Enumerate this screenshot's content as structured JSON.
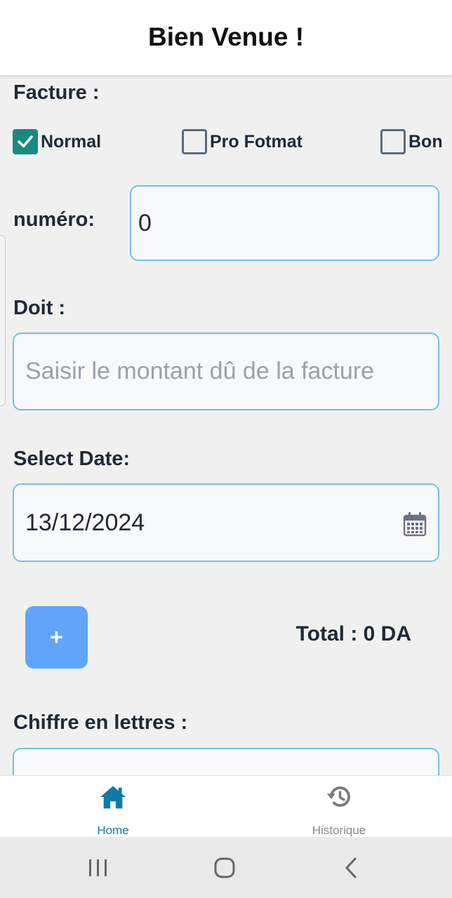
{
  "header": {
    "title": "Bien Venue !"
  },
  "facture": {
    "label": "Facture :",
    "options": [
      {
        "label": "Normal",
        "checked": true
      },
      {
        "label": "Pro Fotmat",
        "checked": false
      },
      {
        "label": "Bon",
        "checked": false
      }
    ]
  },
  "numero": {
    "label": "numéro:",
    "value": "0"
  },
  "doit": {
    "label": "Doit :",
    "placeholder": "Saisir le montant dû de la facture"
  },
  "date": {
    "label": "Select Date:",
    "value": "13/12/2024"
  },
  "add_button": {
    "label": "+"
  },
  "total": {
    "text": "Total : 0 DA"
  },
  "lettres": {
    "label": "Chiffre en lettres :"
  },
  "tabs": [
    {
      "label": "Home",
      "icon": "home-icon",
      "active": true
    },
    {
      "label": "Historique",
      "icon": "history-icon",
      "active": false
    }
  ],
  "system_nav": {
    "recent": "recent-apps-icon",
    "home": "home-circle-icon",
    "back": "back-icon"
  },
  "colors": {
    "accent": "#1a8a7e",
    "input_border": "#6fc3dc",
    "button": "#60a5fa",
    "tab_active": "#0f7aa8",
    "tab_inactive": "#8a8a8a"
  }
}
